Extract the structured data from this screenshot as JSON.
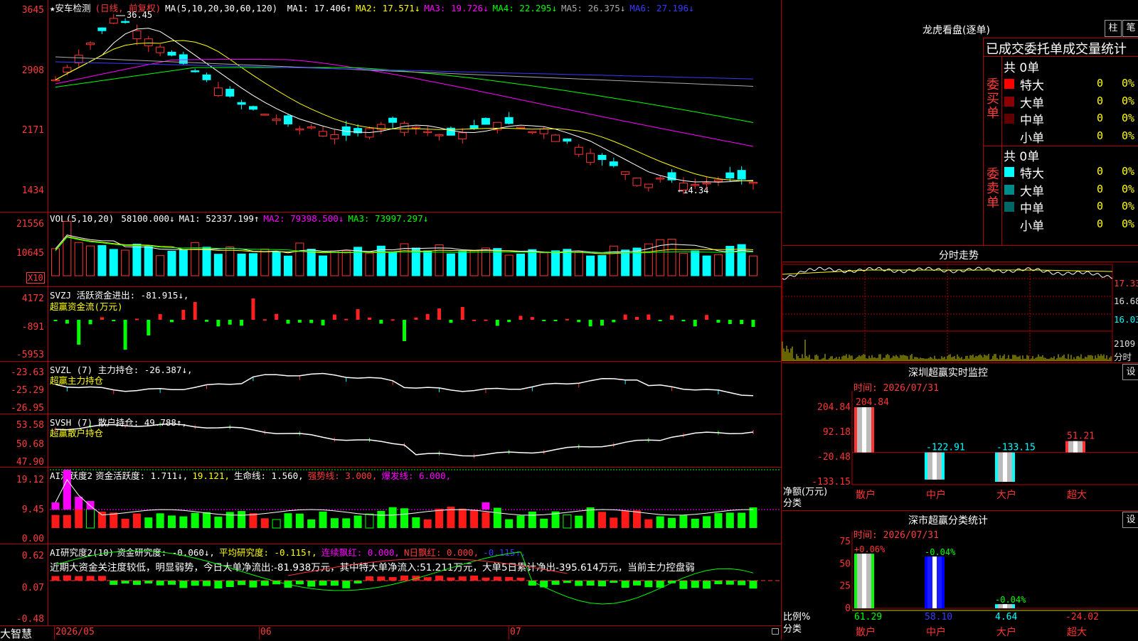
{
  "main": {
    "title_star": "★",
    "stock_name": "安车检测",
    "period": "(日线, 前复权)",
    "ma_label": "MA(5,10,20,30,60,120)",
    "ma": [
      {
        "name": "MA1",
        "value": "17.406↑",
        "color": "#ffffff"
      },
      {
        "name": "MA2",
        "value": "17.571↓",
        "color": "#ffff00"
      },
      {
        "name": "MA3",
        "value": "19.726↓",
        "color": "#ff00ff"
      },
      {
        "name": "MA4",
        "value": "22.295↓",
        "color": "#00ff00"
      },
      {
        "name": "MA5",
        "value": "26.375↓",
        "color": "#aaaaaa"
      },
      {
        "name": "MA6",
        "value": "27.196↓",
        "color": "#3a3aff"
      }
    ],
    "high_label": "36.45",
    "low_label": "←14.34",
    "y_labels": [
      "3645",
      "2908",
      "2171",
      "1434"
    ]
  },
  "vol": {
    "header": "VOL(5,10,20)",
    "value": "58100.000↓",
    "ma": [
      {
        "name": "MA1",
        "value": "52337.199↑",
        "color": "#ffffff"
      },
      {
        "name": "MA2",
        "value": "79398.500↓",
        "color": "#ff00ff"
      },
      {
        "name": "MA3",
        "value": "73997.297↓",
        "color": "#00ff00"
      }
    ],
    "y_labels": [
      "21556",
      "10645"
    ],
    "unit": "X10"
  },
  "svzj": {
    "header": "SVZJ  活跃资金进出: -81.915↓,",
    "sub": "超赢资金流(万元)",
    "y_labels": [
      "4172",
      "-891",
      "-5953"
    ]
  },
  "svzl": {
    "header": "SVZL (7) 主力持仓: -26.387↓,",
    "sub": "超赢主力持仓",
    "y_labels": [
      "-23.63",
      "-25.29",
      "-26.95"
    ]
  },
  "svsh": {
    "header": "SVSH (7) 散户持仓: 49.788↑,",
    "sub": "超赢散户持仓",
    "y_labels": [
      "53.58",
      "50.68",
      "47.90"
    ]
  },
  "ai_active": {
    "header_name": "AI活跃度2",
    "header_main": "资金活跃度: 1.711↓,",
    "header_v2": "19.121,",
    "header_life": "生命线: 1.560,",
    "header_strong": "强势线: 3.000,",
    "header_burst": "爆发线: 6.000,",
    "y_labels": [
      "19.12",
      "9.45",
      "0.00"
    ]
  },
  "ai_research": {
    "header_name": "AI研究度2(10)",
    "header_main": "资金研究度: -0.060↓,",
    "header_avg": "平均研究度: -0.115↑,",
    "header_red": "连续飘红: 0.000,",
    "header_n": "N日飘红: 0.000,",
    "header_last": "-0.115↑,",
    "commentary": "近期大资金关注度较低，明显弱势，今日大单净流出:-81.938万元，其中特大单净流入:51.211万元，大单5日累计净出-395.614万元，当前主力控盘弱",
    "y_labels": [
      "0.62",
      "0.07",
      "-0.48"
    ]
  },
  "bottom": {
    "brand": "大智慧",
    "dates": [
      "2026/05",
      "06",
      "07"
    ]
  },
  "lhb": {
    "title": "龙虎看盘(逐单)",
    "btn_bar": "柱",
    "btn_pen": "笔",
    "table_title": "已成交委托单成交量统计",
    "buy": {
      "side": "委买单",
      "total": "共 0单",
      "rows": [
        {
          "label": "特大",
          "count": "0",
          "pct": "0%",
          "color": "#ff0000"
        },
        {
          "label": "大单",
          "count": "0",
          "pct": "0%",
          "color": "#8b0000"
        },
        {
          "label": "中单",
          "count": "0",
          "pct": "0%",
          "color": "#600000"
        },
        {
          "label": "小单",
          "count": "0",
          "pct": "0%",
          "color": ""
        }
      ]
    },
    "sell": {
      "side": "委卖单",
      "total": "共 0单",
      "rows": [
        {
          "label": "特大",
          "count": "0",
          "pct": "0%",
          "color": "#00ffff"
        },
        {
          "label": "大单",
          "count": "0",
          "pct": "0%",
          "color": "#008b8b"
        },
        {
          "label": "中单",
          "count": "0",
          "pct": "0%",
          "color": "#006666"
        },
        {
          "label": "小单",
          "count": "0",
          "pct": "0%",
          "color": ""
        }
      ]
    }
  },
  "intraday": {
    "title": "分时走势",
    "price_labels": [
      "17.33",
      "16.68",
      "16.03"
    ],
    "vol_label": "2109",
    "fen_label": "分时"
  },
  "sz_monitor": {
    "title": "深圳超赢实时监控",
    "btn": "设",
    "time": "时间: 2026/07/31",
    "y_labels": [
      "204.84",
      "92.18",
      "-20.48",
      "-133.15"
    ],
    "unit": "净额(万元)",
    "cat_label": "分类",
    "bars": [
      {
        "cat": "散户",
        "value": 204.84,
        "label": "204.84",
        "color": "#ff3333"
      },
      {
        "cat": "中户",
        "value": -122.91,
        "label": "-122.91",
        "color": "#00ffff"
      },
      {
        "cat": "大户",
        "value": -133.15,
        "label": "-133.15",
        "color": "#00ffff"
      },
      {
        "cat": "超大",
        "value": 51.21,
        "label": "51.21",
        "color": "#ff3333"
      }
    ]
  },
  "sz_class": {
    "title": "深市超赢分类统计",
    "btn": "设",
    "time": "时间: 2026/07/31",
    "y_labels": [
      "75",
      "50",
      "25",
      "0"
    ],
    "unit": "比例%",
    "cat_label": "分类",
    "bars": [
      {
        "cat": "散户",
        "value": 61.29,
        "label": "61.29",
        "top": "+0.06%",
        "color": "#00ff00",
        "toplabel_color": "#ff3333"
      },
      {
        "cat": "中户",
        "value": 58.1,
        "label": "58.10",
        "top": "-0.04%",
        "color": "#0000ff",
        "toplabel_color": "#00ff00"
      },
      {
        "cat": "大户",
        "value": 4.64,
        "label": "4.64",
        "top": "-0.04%",
        "color": "#00ffff",
        "toplabel_color": "#00ff00"
      },
      {
        "cat": "超大",
        "value": -24.02,
        "label": "-24.02",
        "top": "",
        "color": "#ff3333",
        "toplabel_color": "#ff3333"
      }
    ]
  }
}
